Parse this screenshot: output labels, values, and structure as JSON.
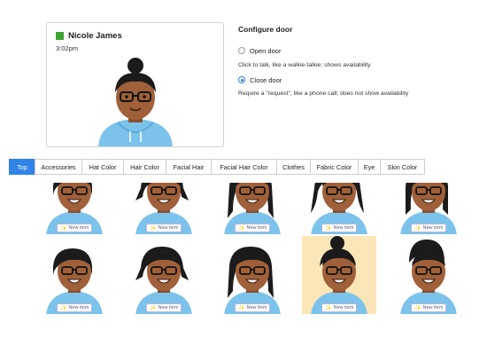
{
  "user": {
    "name": "Nicole James",
    "time": "3:02pm",
    "status_color": "#3fa535"
  },
  "config": {
    "title": "Configure door",
    "options": [
      {
        "label": "Open door",
        "description": "Click to talk, like a walkie-talkie; shows availability",
        "checked": false
      },
      {
        "label": "Close door",
        "description": "Require a \"request\", like a phone call; does not show availability",
        "checked": true
      }
    ]
  },
  "tabs": [
    "Top",
    "Accessories",
    "Hat Color",
    "Hair Color",
    "Facial Hair",
    "Facial Hair Color",
    "Clothes",
    "Fabric Color",
    "Eye",
    "Skin Color"
  ],
  "active_tab": "Top",
  "badge_label": "New item",
  "colors": {
    "accent": "#2f84e8",
    "selected_bg": "#fbe6b8",
    "skin": "#a0603a",
    "hair": "#1b1b1b",
    "hoodie": "#7cc3ec"
  }
}
